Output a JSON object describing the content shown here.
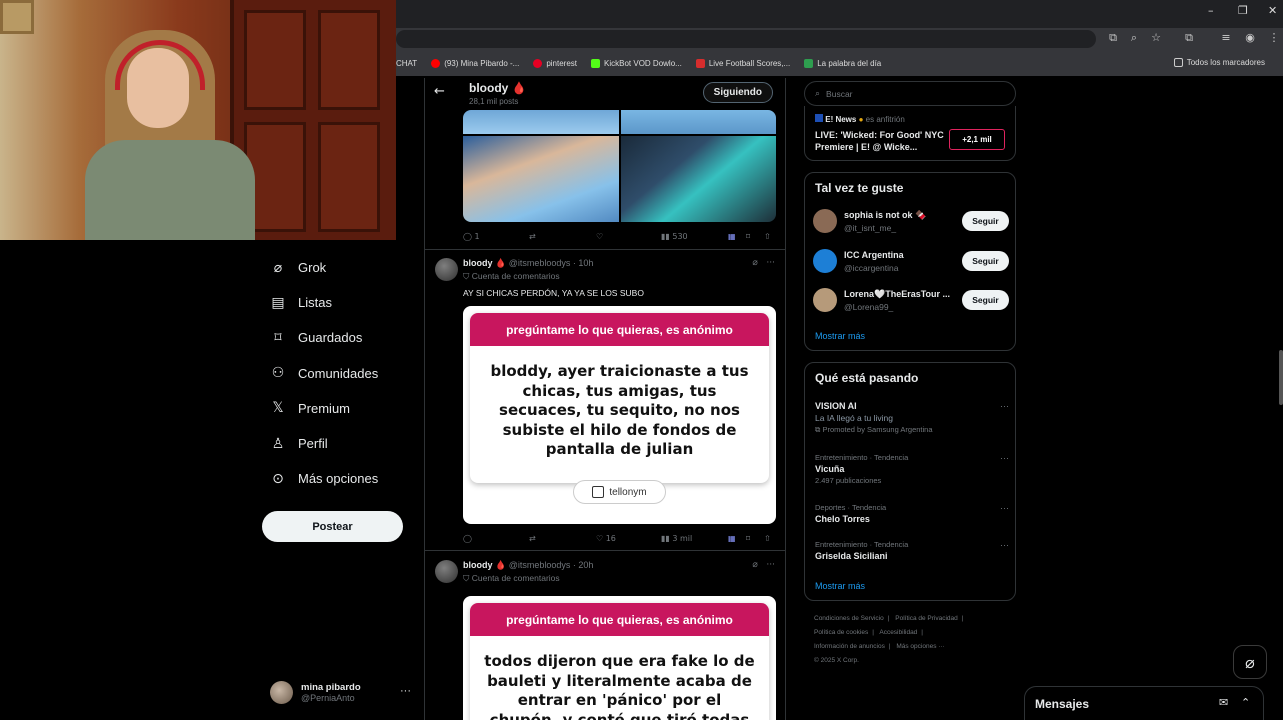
{
  "bookmarks": [
    {
      "label": "CHAT",
      "color": "#444"
    },
    {
      "label": "(93) Mina Pibardo -...",
      "color": "#ff0000"
    },
    {
      "label": "pinterest",
      "color": "#e60023"
    },
    {
      "label": "KickBot VOD Dowlo...",
      "color": "#53fc18"
    },
    {
      "label": "Live Football Scores,...",
      "color": "#d62d2d"
    },
    {
      "label": "La palabra del día",
      "color": "#2e9e4f"
    }
  ],
  "bookmarks_all": "Todos los marcadores",
  "nav": {
    "items": [
      {
        "label": "Grok",
        "icon": "grok-icon"
      },
      {
        "label": "Listas",
        "icon": "list-icon"
      },
      {
        "label": "Guardados",
        "icon": "bookmark-icon"
      },
      {
        "label": "Comunidades",
        "icon": "communities-icon"
      },
      {
        "label": "Premium",
        "icon": "x-icon"
      },
      {
        "label": "Perfil",
        "icon": "person-icon"
      },
      {
        "label": "Más opciones",
        "icon": "more-circle-icon"
      }
    ],
    "post_button": "Postear"
  },
  "account": {
    "name": "mina pibardo",
    "handle": "@PerniaAnto"
  },
  "header": {
    "name": "bloody 🩸",
    "subtitle": "28,1 mil posts",
    "follow_label": "Siguiendo"
  },
  "tweet0": {
    "replies": "1",
    "views": "530"
  },
  "tweet1": {
    "name": "bloody 🩸",
    "meta": "@itsmebloodys · 10h",
    "badge": "Cuenta de comentarios",
    "text": "AY SI CHICAS PERDÓN, YA YA SE LOS SUBO",
    "card_header": "pregúntame lo que quieras, es anónimo",
    "card_text": "bloddy, ayer traicionaste a tus chicas, tus amigas, tus secuaces, tu sequito, no nos subiste el hilo de fondos de pantalla de julian",
    "card_brand": "tellonym",
    "likes": "16",
    "views": "3 mil"
  },
  "tweet2": {
    "name": "bloody 🩸",
    "meta": "@itsmebloodys · 20h",
    "badge": "Cuenta de comentarios",
    "card_header": "pregúntame lo que quieras, es anónimo",
    "card_text": "todos dijeron que era fake lo de bauleti y literalmente acaba de entrar en 'pánico' por el chupón, y conté que tiró todas las cosas"
  },
  "search": {
    "placeholder": "Buscar"
  },
  "live": {
    "host": "E! News",
    "host_suffix": "es anfitrión",
    "title": "LIVE: 'Wicked: For Good' NYC Premiere | E! @ Wicke...",
    "badge": "+2,1 mil"
  },
  "who_to_follow": {
    "title": "Tal vez te guste",
    "follow_label": "Seguir",
    "show_more": "Mostrar más",
    "users": [
      {
        "name": "sophia is not ok 🍫",
        "handle": "@it_isnt_me_",
        "avatar_color": "#8a6a55"
      },
      {
        "name": "ICC Argentina",
        "handle": "@iccargentina",
        "avatar_color": "#1d7fd6"
      },
      {
        "name": "Lorena🤍TheErasTour ...",
        "handle": "@Lorena99_",
        "avatar_color": "#b69a7a"
      }
    ]
  },
  "trends": {
    "title": "Qué está pasando",
    "show_more": "Mostrar más",
    "items": [
      {
        "meta": "",
        "name": "VISION AI",
        "detail": "La IA llegó a tu living",
        "promo": "Promoted by Samsung Argentina"
      },
      {
        "meta": "Entretenimiento · Tendencia",
        "name": "Vicuña",
        "detail": "2.497 publicaciones",
        "promo": ""
      },
      {
        "meta": "Deportes · Tendencia",
        "name": "Chelo Torres",
        "detail": "",
        "promo": ""
      },
      {
        "meta": "Entretenimiento · Tendencia",
        "name": "Griselda Siciliani",
        "detail": "",
        "promo": ""
      }
    ]
  },
  "footer": {
    "links": [
      "Condiciones de Servicio",
      "|",
      "Política de Privacidad",
      "|",
      "Política de cookies",
      "|",
      "Accesibilidad",
      "|",
      "Información de anuncios",
      "|",
      "Más opciones ···",
      "© 2025 X Corp."
    ]
  },
  "messages": {
    "title": "Mensajes"
  }
}
